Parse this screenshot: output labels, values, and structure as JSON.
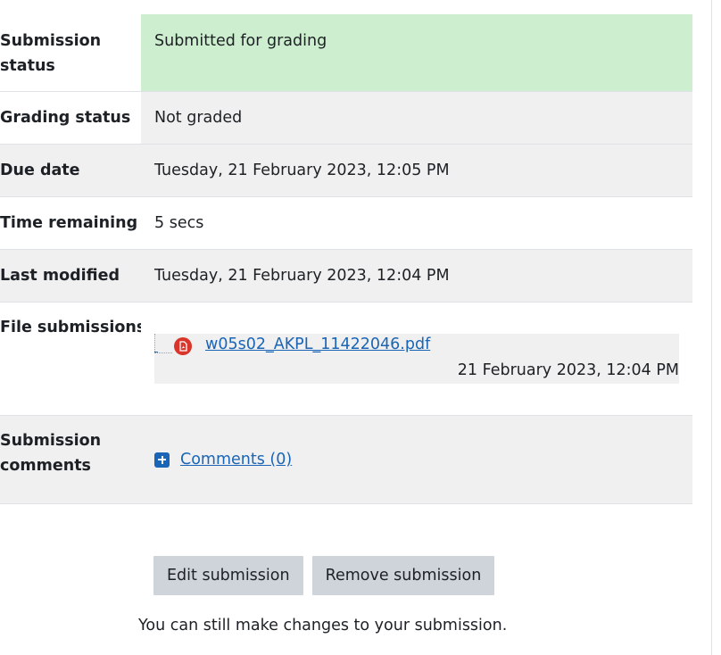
{
  "status_table": {
    "submission_status": {
      "label": "Submission status",
      "value": "Submitted for grading"
    },
    "grading_status": {
      "label": "Grading status",
      "value": "Not graded"
    },
    "due_date": {
      "label": "Due date",
      "value": "Tuesday, 21 February 2023, 12:05 PM"
    },
    "time_remaining": {
      "label": "Time remaining",
      "value": "5 secs"
    },
    "last_modified": {
      "label": "Last modified",
      "value": "Tuesday, 21 February 2023, 12:04 PM"
    },
    "file_submissions": {
      "label": "File submissions",
      "file_name": "w05s02_AKPL_11422046.pdf",
      "file_date": "21 February 2023, 12:04 PM",
      "file_icon": "pdf-icon"
    },
    "submission_comments": {
      "label": "Submission comments",
      "link": "Comments (0)",
      "icon": "plus-square-icon"
    }
  },
  "actions": {
    "edit_label": "Edit submission",
    "remove_label": "Remove submission",
    "note": "You can still make changes to your submission."
  },
  "colors": {
    "success_bg": "#cdefcf",
    "link": "#1a65b5",
    "button_bg": "#ced4da",
    "row_alt_bg": "#f0f0f0"
  }
}
